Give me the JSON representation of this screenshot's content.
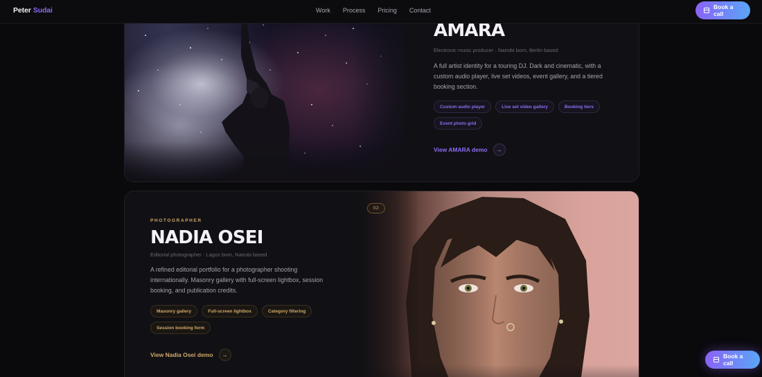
{
  "nav": {
    "logo_first": "Peter",
    "logo_second": "Sudai",
    "links": [
      "Work",
      "Process",
      "Pricing",
      "Contact"
    ],
    "cta_label": "Book a call"
  },
  "floating_cta": {
    "label": "Book a call"
  },
  "projects": [
    {
      "title": "AMARA",
      "subtitle": "Electronic music producer · Nairobi born, Berlin based",
      "description": "A full artist identity for a touring DJ. Dark and cinematic, with a custom audio player, live set videos, event gallery, and a tiered booking section.",
      "tags": [
        "Custom audio player",
        "Live set video gallery",
        "Booking tiers",
        "Event photo grid"
      ],
      "cta": "View AMARA demo",
      "accent": "#8e6cf4"
    },
    {
      "eyebrow": "PHOTOGRAPHER",
      "badge": "02",
      "title": "NADIA OSEI",
      "subtitle": "Editorial photographer · Lagos born, Nairobi based",
      "description": "A refined editorial portfolio for a photographer shooting internationally. Masonry gallery with full-screen lightbox, session booking, and publication credits.",
      "tags": [
        "Masonry gallery",
        "Full-screen lightbox",
        "Category filtering",
        "Session booking form"
      ],
      "cta": "View Nadia Osei demo",
      "accent": "#d1aa6a"
    }
  ]
}
